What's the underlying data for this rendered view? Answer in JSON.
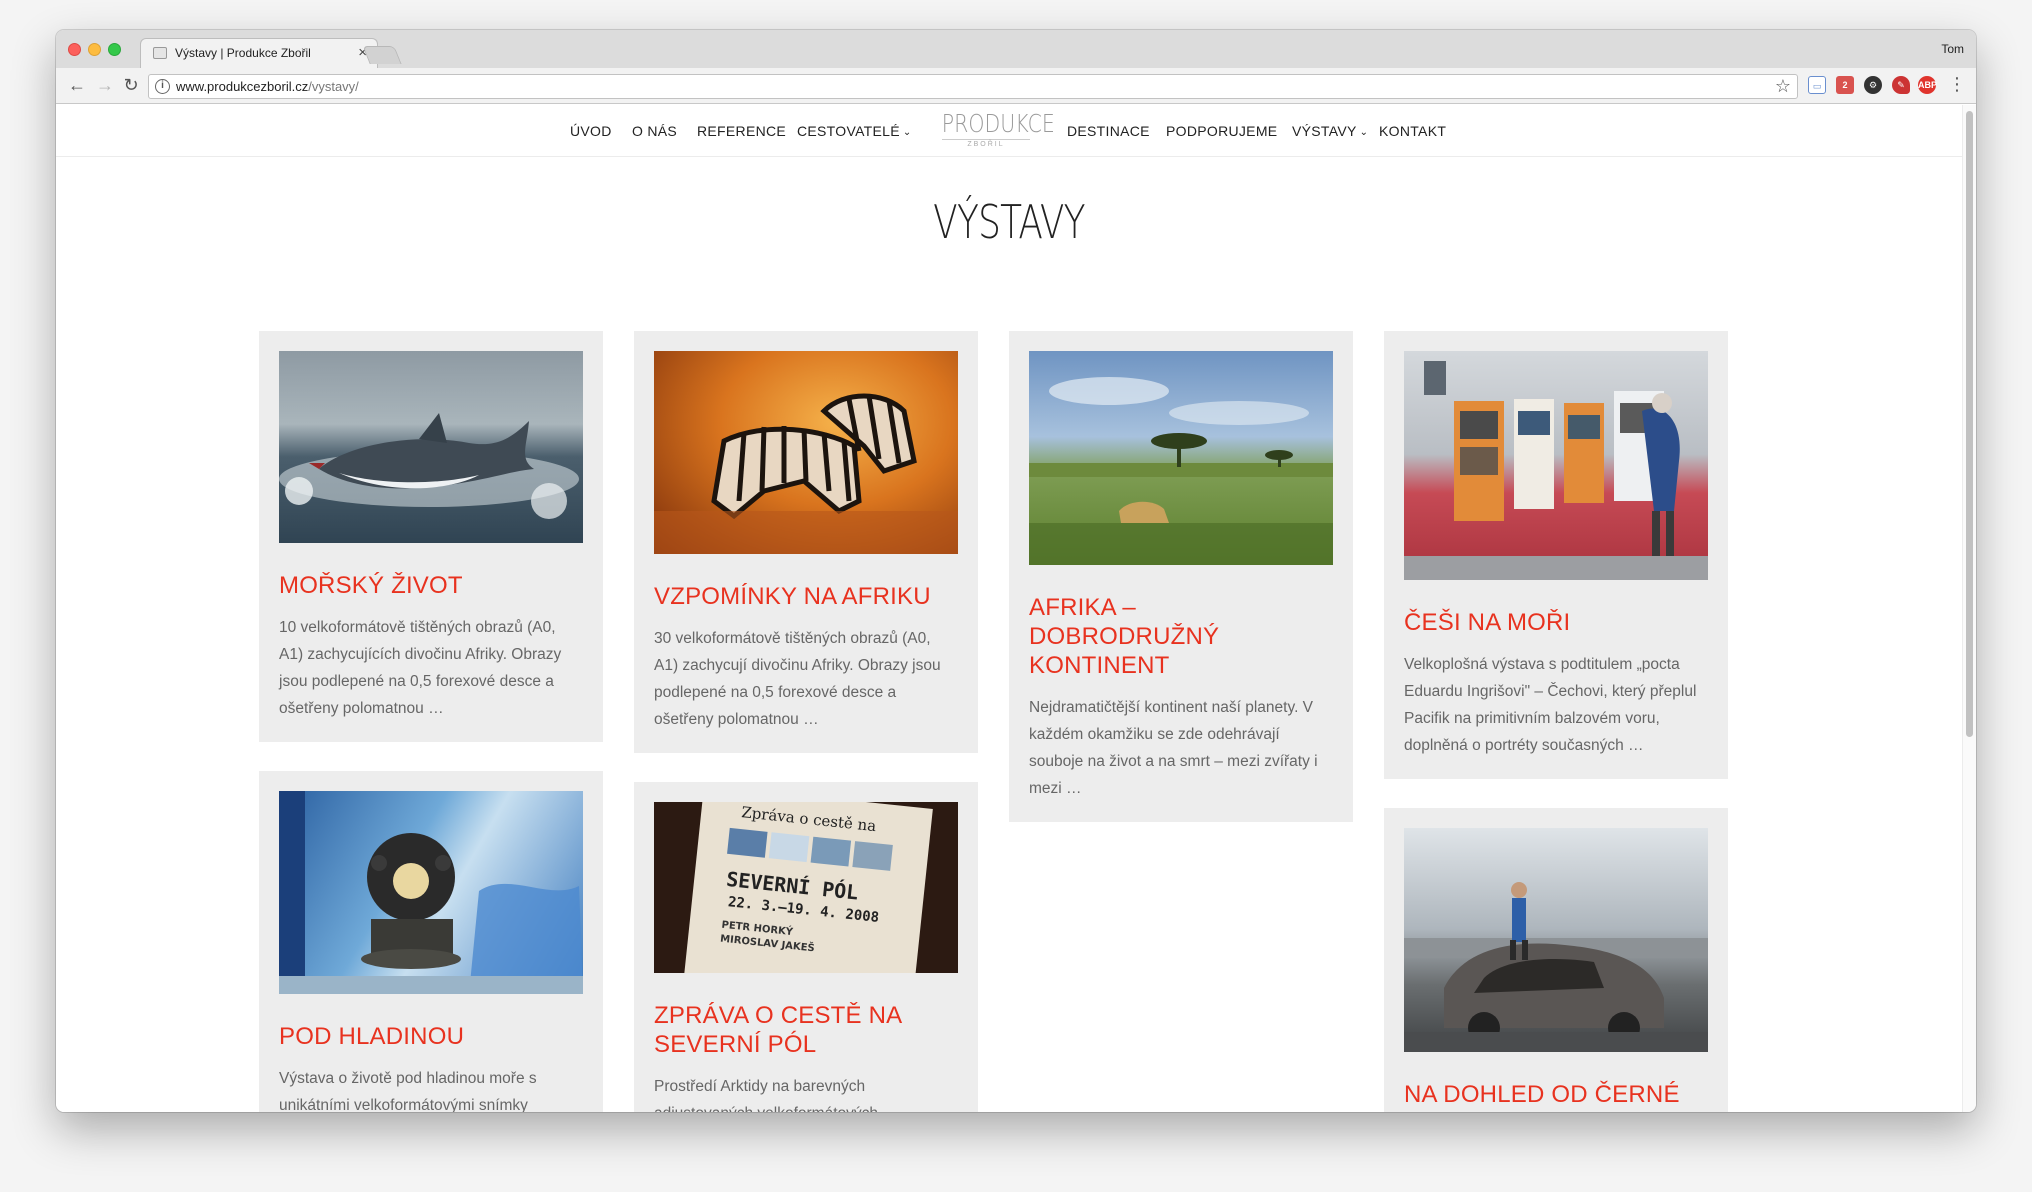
{
  "browser": {
    "tab_title": "Výstavy | Produkce Zbořil",
    "tab_close": "×",
    "profile": "Tom",
    "url_host": "www.produkcezboril.cz",
    "url_path": "/vystavy/",
    "icons": [
      "back-icon",
      "forward-icon",
      "reload-icon",
      "info-icon",
      "star-icon",
      "menu-icon"
    ]
  },
  "nav": {
    "left": [
      "ÚVOD",
      "O NÁS",
      "REFERENCE",
      "CESTOVATELÉ"
    ],
    "right": [
      "DESTINACE",
      "PODPORUJEME",
      "VÝSTAVY",
      "KONTAKT"
    ],
    "dropdown_caret": "⌄"
  },
  "logo": {
    "main": "PRODUKCE",
    "sub": "ZBOŘIL"
  },
  "page": {
    "title": "VÝSTAVY"
  },
  "cards": [
    {
      "title": "MOŘSKÝ ŽIVOT",
      "text": "10 velkoformátově tištěných obrazů (A0, A1) zachycujících divočinu Afriky. Obrazy jsou podlepené na 0,5 forexové desce a ošetřeny polomatnou …"
    },
    {
      "title": "VZPOMÍNKY NA AFRIKU",
      "text": "30 velkoformátově tištěných obrazů (A0, A1) zachycují divočinu Afriky. Obrazy jsou podlepené na 0,5 forexové desce a ošetřeny polomatnou …"
    },
    {
      "title": "AFRIKA – DOBRODRUŽNÝ KONTINENT",
      "text": "Nejdramatičtější kontinent naší planety. V každém okamžiku se zde odehrávají souboje na život a na smrt – mezi zvířaty i mezi …"
    },
    {
      "title": "ČEŠI NA MOŘI",
      "text": "Velkoplošná výstava s podtitulem „pocta Eduardu Ingrišovi\" – Čechovi, který přeplul Pacifik na primitivním balzovém voru, doplněná o portréty současných …"
    },
    {
      "title": "POD HLADINOU",
      "text": "Výstava o životě pod hladinou moře s unikátními velkoformátovými snímky Richarda Jaroňka, maketou žraloka"
    },
    {
      "title": "ZPRÁVA O CESTĚ NA SEVERNÍ PÓL",
      "text": "Prostředí Arktidy na barevných adjustovaných velkoformátových fotografiích doplněných o trojrozměrné"
    },
    {
      "title": "NA DOHLED OD ČERNÉ VLAJKY",
      "text": ""
    }
  ],
  "poster": {
    "line1": "Zpráva o cestě na",
    "line2": "SEVERNÍ PÓL",
    "line3": "22. 3.–19. 4. 2008",
    "line4": "PETR HORKÝ",
    "line5": "MIROSLAV JAKEŠ"
  },
  "colors": {
    "accent": "#e8321f",
    "card_bg": "#ededed",
    "text": "#666666"
  }
}
